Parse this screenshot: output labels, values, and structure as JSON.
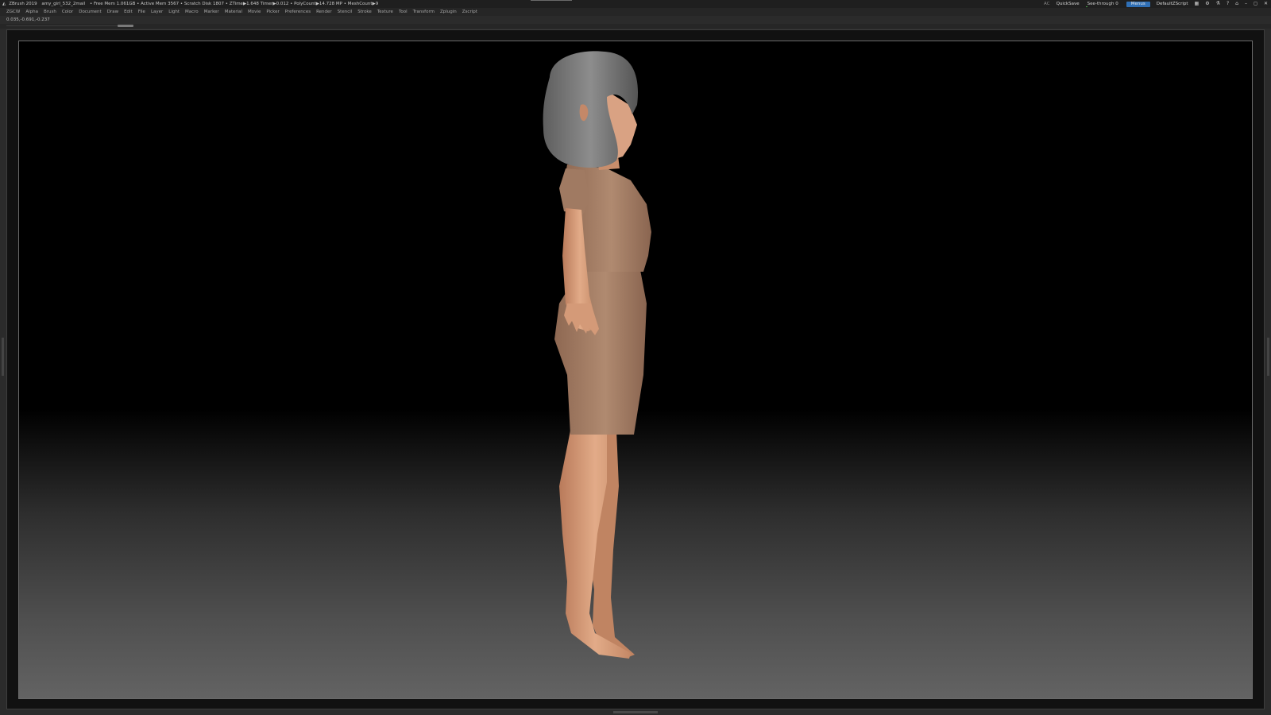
{
  "titlebar": {
    "app_name": "ZBrush 2019",
    "file_name": "amy_girl_532_2mail",
    "stats": "• Free Mem 1.061GB • Active Mem 3567 • Scratch Disk 1807 • ZTime▶1.648 Timer▶0.012 • PolyCount▶14.728 MP • MeshCount▶9",
    "ac": "AC",
    "quicksave": "QuickSave",
    "see_through": "See-through 0",
    "see_through_level": 0,
    "menus": "Menus",
    "default_script": "DefaultZScript",
    "accent_color": "#2f6fb5"
  },
  "menubar": {
    "items": [
      "ZGCW",
      "Alpha",
      "Brush",
      "Color",
      "Document",
      "Draw",
      "Edit",
      "File",
      "Layer",
      "Light",
      "Macro",
      "Marker",
      "Material",
      "Movie",
      "Picker",
      "Preferences",
      "Render",
      "Stencil",
      "Stroke",
      "Texture",
      "Tool",
      "Transform",
      "Zplugin",
      "Zscript"
    ]
  },
  "coords": {
    "text": "0.035,-0.691,-0.237"
  },
  "viewport": {
    "subject": "3D sculpted girl model, side view, tan dress, grey bob hair",
    "skin_color": "#d8a07d",
    "dress_color": "#a67e64",
    "hair_color": "#7c7c7c"
  }
}
